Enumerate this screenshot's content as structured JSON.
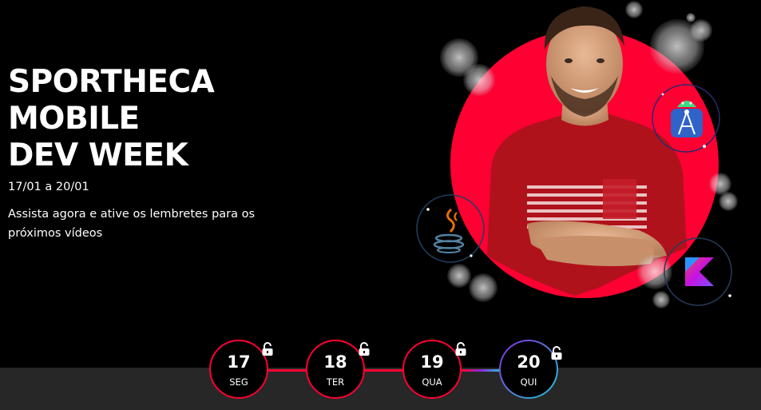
{
  "hero": {
    "title": "SPORTHECA\nMOBILE\nDEV WEEK",
    "dates": "17/01 a 20/01",
    "description": "Assista agora e ative os lembretes para os próximos vídeos"
  },
  "timeline": {
    "days": [
      {
        "number": "17",
        "weekday": "SEG",
        "lock": "open-lock-icon"
      },
      {
        "number": "18",
        "weekday": "TER",
        "lock": "open-lock-icon"
      },
      {
        "number": "19",
        "weekday": "QUA",
        "lock": "open-lock-icon"
      },
      {
        "number": "20",
        "weekday": "QUI",
        "lock": "open-lock-icon"
      }
    ]
  },
  "colors": {
    "background": "#000000",
    "accent_red": "#ff0033",
    "gradient_purple": "#8a2be2",
    "gradient_cyan": "#20c8d8",
    "bottom_bar": "#272727"
  },
  "icons": [
    "android-studio-icon",
    "java-icon",
    "kotlin-icon"
  ]
}
